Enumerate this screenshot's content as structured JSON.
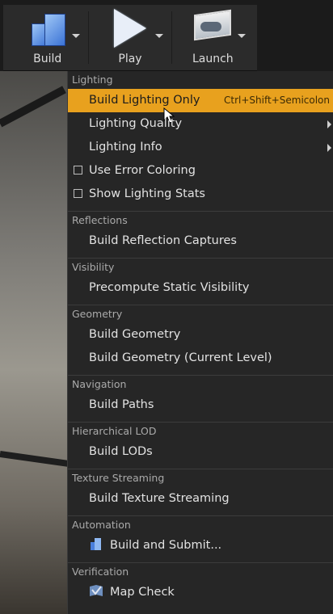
{
  "toolbar": {
    "buttons": [
      {
        "label": "Build",
        "icon": "build-cubes-icon"
      },
      {
        "label": "Play",
        "icon": "play-icon"
      },
      {
        "label": "Launch",
        "icon": "launch-monitor-icon"
      }
    ]
  },
  "menu": {
    "sections": [
      {
        "heading": "Lighting",
        "items": [
          {
            "label": "Build Lighting Only",
            "shortcut": "Ctrl+Shift+Semicolon",
            "highlighted": true
          },
          {
            "label": "Lighting Quality",
            "submenu": true
          },
          {
            "label": "Lighting Info",
            "submenu": true
          },
          {
            "label": "Use Error Coloring",
            "checkbox": false
          },
          {
            "label": "Show Lighting Stats",
            "checkbox": false
          }
        ]
      },
      {
        "heading": "Reflections",
        "items": [
          {
            "label": "Build Reflection Captures"
          }
        ]
      },
      {
        "heading": "Visibility",
        "items": [
          {
            "label": "Precompute Static Visibility"
          }
        ]
      },
      {
        "heading": "Geometry",
        "items": [
          {
            "label": "Build Geometry"
          },
          {
            "label": "Build Geometry (Current Level)"
          }
        ]
      },
      {
        "heading": "Navigation",
        "items": [
          {
            "label": "Build Paths"
          }
        ]
      },
      {
        "heading": "Hierarchical LOD",
        "items": [
          {
            "label": "Build LODs"
          }
        ]
      },
      {
        "heading": "Texture Streaming",
        "items": [
          {
            "label": "Build Texture Streaming"
          }
        ]
      },
      {
        "heading": "Automation",
        "items": [
          {
            "label": "Build and Submit...",
            "icon": "build-submit-icon"
          }
        ]
      },
      {
        "heading": "Verification",
        "items": [
          {
            "label": "Map Check",
            "icon": "map-check-icon"
          }
        ]
      }
    ]
  },
  "colors": {
    "highlight": "#e8a11e",
    "menu_bg": "#262626",
    "toolbar_bg": "#2b2b2b"
  }
}
